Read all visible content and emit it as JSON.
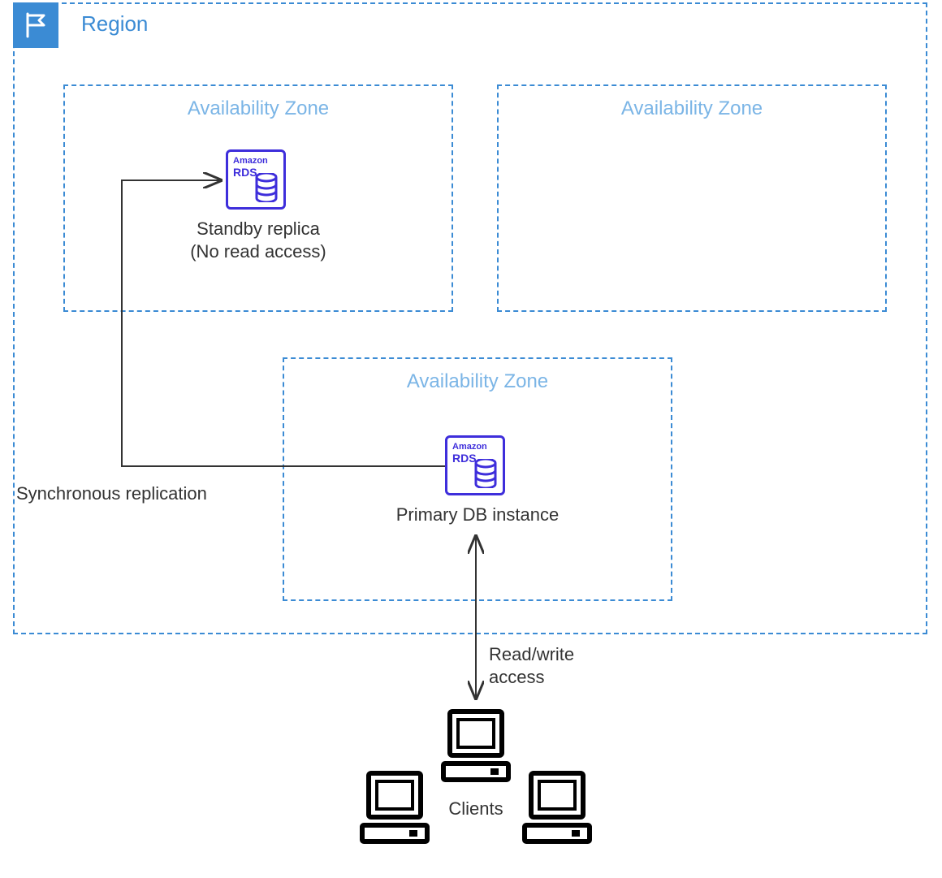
{
  "region": {
    "title": "Region",
    "icon": "flag-icon"
  },
  "availability_zones": {
    "az1": {
      "title": "Availability Zone"
    },
    "az2": {
      "title": "Availability Zone"
    },
    "az3": {
      "title": "Availability Zone"
    }
  },
  "rds": {
    "brand": "Amazon",
    "product": "RDS"
  },
  "nodes": {
    "standby": {
      "label_line1": "Standby replica",
      "label_line2": "(No read access)"
    },
    "primary": {
      "label": "Primary DB instance"
    }
  },
  "connections": {
    "replication_label": "Synchronous replication",
    "client_access_line1": "Read/write",
    "client_access_line2": "access"
  },
  "clients": {
    "label": "Clients"
  },
  "colors": {
    "aws_blue": "#3B8BD4",
    "aws_light_blue": "#7BB5E6",
    "rds_purple": "#3E2EDB",
    "text": "#333333"
  }
}
